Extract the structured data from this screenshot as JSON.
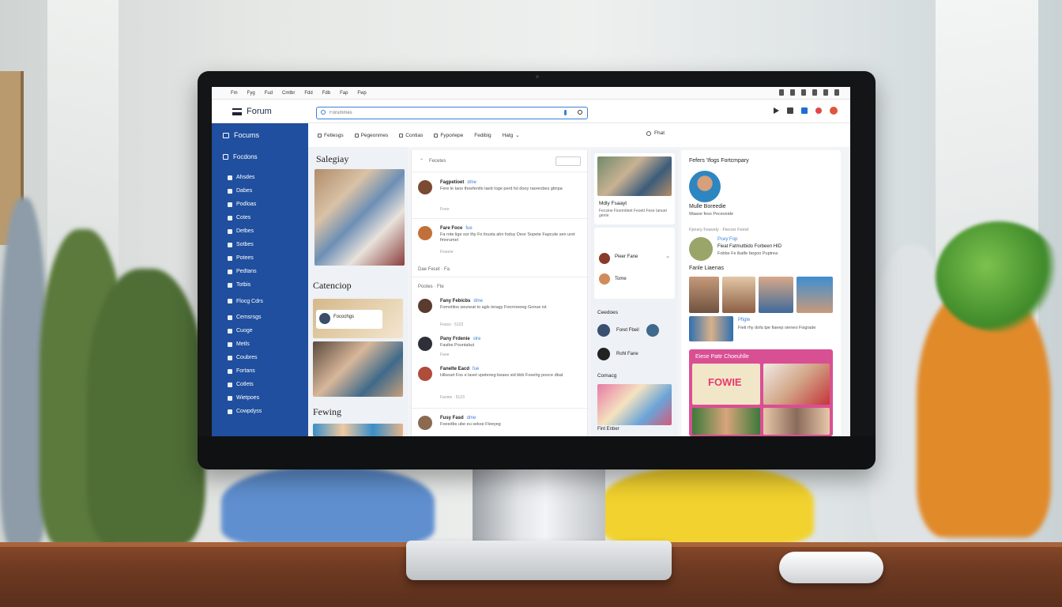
{
  "menubar": {
    "items": [
      "Fm",
      "Fyg",
      "Fud",
      "Cmtbr",
      "Fdd",
      "Fdb",
      "Fap",
      "Fwp"
    ]
  },
  "appbar": {
    "brand": "Forum",
    "search_placeholder": "Forummes"
  },
  "sidebar": {
    "title": "Focums",
    "section": "Focdons",
    "items": [
      "Ahsdes",
      "Dabes",
      "Podloas",
      "Cotes",
      "Detbes",
      "Sotbes",
      "Potees",
      "Pedtans",
      "Totbis",
      "Flocg Cdrs",
      "Cemsrsgs",
      "Cuoge",
      "Metls",
      "Coubres",
      "Fortans",
      "Cotlets",
      "Wietpoes",
      "Cowpdyss"
    ]
  },
  "nav": {
    "items": [
      "Fetlesgs",
      "Pegeonmes",
      "Contias",
      "Fyporlepe",
      "Fedibig",
      "Hatg"
    ],
    "search_label": "Fhat"
  },
  "col1": {
    "section1": "Salegiay",
    "section2": "Catenciop",
    "card_label": "Focochgs",
    "section3": "Fewing"
  },
  "col2": {
    "header": "Fecetes",
    "posts": [
      {
        "name": "Fagpetioet",
        "tag": "dme",
        "text": "Fere le taos thoefentlo laeb Ioge perd ful dooy raorecbes gtinpa",
        "meta": "Fooo"
      },
      {
        "name": "Fare Foce",
        "tag": "fue",
        "text": "Fa rote lige sor thy Fo lirusta ahn foduy Deor Sopete Fapcute sen uret fmnrumel",
        "meta": "Fosone"
      },
      {
        "name": "Fany Febicbs",
        "tag": "dme",
        "text": "Fomotilos seuneat to agls teragy Fonrroeeeg Gonue ist",
        "meta": "Fosso  ·  5123"
      },
      {
        "name": "Pany Frdenie",
        "tag": "slre",
        "text": "Fasibe Pountabut",
        "meta": "Fane"
      },
      {
        "name": "Fanelte Eacd",
        "tag": "fue",
        "text": "Hikeset Fos e lavet vpeleneg beaes sid bbb Foeehg pooce dbat",
        "meta": "Fanine  ·  5123"
      },
      {
        "name": "Fusy Fasd",
        "tag": "dme",
        "text": "Foeedbs ube eu sekse Fleeyeg",
        "meta": ""
      }
    ],
    "sub_head1": "Dae Fecet  ·  Fa",
    "sub_head2": "Pootes  ·  Fte"
  },
  "col3": {
    "card1_title": "Mdly Fsaayt",
    "card1_sub": "Fecsine Fioerntleet Feoett Fese Ianuet gente",
    "people": [
      "Pieer Fane",
      "Tome"
    ],
    "section2": "Ceedoes",
    "people2": [
      "Foret Fbeil",
      "Rohl Fane"
    ],
    "section3": "Comacg",
    "footer": "Fint Enber"
  },
  "col4": {
    "header": "Fefers 'Ifogs Fortcmpary",
    "profile_name": "Mulle Boreedie",
    "profile_sub": "Waase feso Peceveide",
    "row_label": "Fpnsry Feavely · Fiecrer Femd",
    "user_name": "Pcey Fop",
    "user_text": "Fieat Fatmutbido Forbeen HID",
    "user_sub": "Fobbe Fe lbalfe fargoo Puptrea",
    "gallery_title": "Fanle Liaenas",
    "mini_name": "Pfigte",
    "mini_text": "Fieti rhy dofa tpe fiaeep oieneo Fisgrade",
    "pink_title": "Eiese Pattr Choeuhlle",
    "poster_text": "FOWIE"
  },
  "colors": {
    "sidebar": "#1f4f9e",
    "accent": "#3b7fd8",
    "pink": "#d94f93"
  }
}
